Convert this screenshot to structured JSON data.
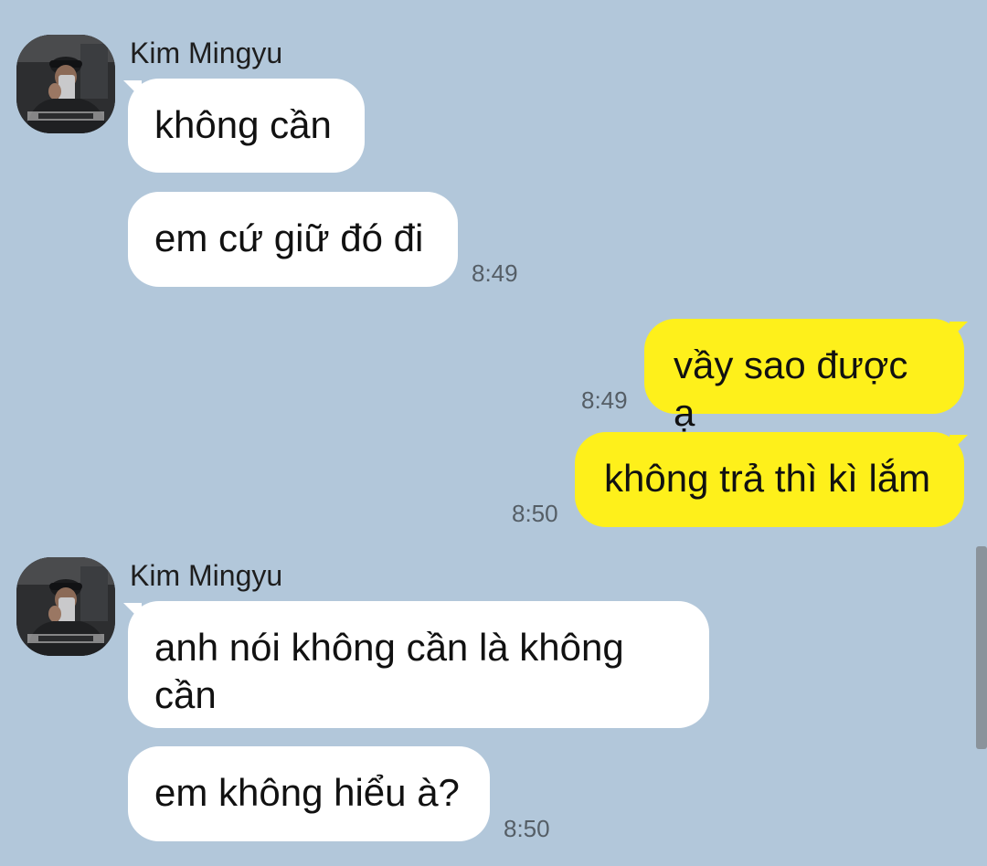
{
  "colors": {
    "background": "#b2c7da",
    "incoming_bubble": "#ffffff",
    "outgoing_bubble": "#fef01b",
    "timestamp": "#555e66"
  },
  "messages": [
    {
      "sender": "Kim Mingyu",
      "direction": "incoming",
      "avatar_icon": "profile-photo-icon",
      "bubbles": [
        "không cần",
        "em cứ giữ đó đi"
      ],
      "time": "8:49"
    },
    {
      "direction": "outgoing",
      "bubbles": [
        "vầy sao được ạ"
      ],
      "time": "8:49"
    },
    {
      "direction": "outgoing",
      "bubbles": [
        "không trả thì kì lắm"
      ],
      "time": "8:50"
    },
    {
      "sender": "Kim Mingyu",
      "direction": "incoming",
      "avatar_icon": "profile-photo-icon",
      "bubbles": [
        "anh nói không cần là không cần",
        "em không hiểu à?"
      ],
      "time": "8:50"
    }
  ]
}
